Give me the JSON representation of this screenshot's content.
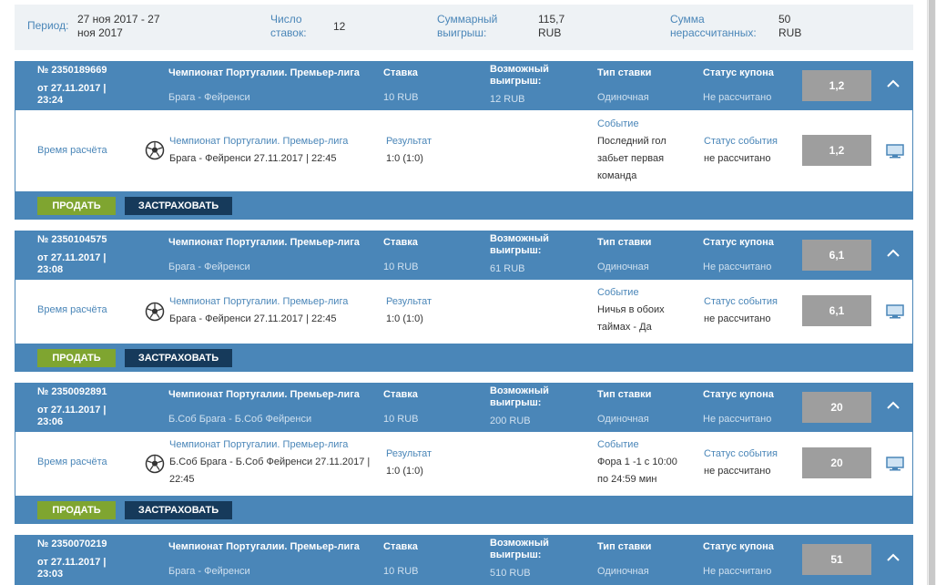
{
  "summary": {
    "period_label": "Период:",
    "period_value_1": "27 ноя 2017 - 27",
    "period_value_2": "ноя 2017",
    "count_label_1": "Число",
    "count_label_2": "ставок:",
    "count_value": "12",
    "win_label_1": "Суммарный",
    "win_label_2": "выигрыш:",
    "win_value_1": "115,7",
    "win_value_2": "RUB",
    "unsettled_label_1": "Сумма",
    "unsettled_label_2": "нерассчитанных:",
    "unsettled_value_1": "50",
    "unsettled_value_2": "RUB"
  },
  "labels": {
    "stake": "Ставка",
    "possible_win_1": "Возможный",
    "possible_win_2": "выигрыш:",
    "bet_type": "Тип ставки",
    "coupon_status": "Статус купона",
    "calc_time": "Время расчёта",
    "result": "Результат",
    "event": "Событие",
    "event_status": "Статус события",
    "sell": "ПРОДАТЬ",
    "insure": "ЗАСТРАХОВАТЬ"
  },
  "bets": [
    {
      "number": "№ 2350189669",
      "date_1": "от 27.11.2017 |",
      "date_2": "23:24",
      "league": "Чемпионат Португалии. Премьер-лига",
      "match": "Брага - Фейренси",
      "stake": "10 RUB",
      "possible_win": "12 RUB",
      "bet_type": "Одиночная",
      "coupon_status": "Не рассчитано",
      "coef": "1,2",
      "detail_league": "Чемпионат Португалии. Премьер-лига",
      "detail_match_1": "Брага - Фейренси 27.11.2017 | 22:45",
      "detail_match_2": "",
      "result": "1:0 (1:0)",
      "event_1": "Последний гол",
      "event_2": "забьет первая",
      "event_3": "команда",
      "event_status": "не рассчитано",
      "detail_coef": "1,2"
    },
    {
      "number": "№ 2350104575",
      "date_1": "от 27.11.2017 |",
      "date_2": "23:08",
      "league": "Чемпионат Португалии. Премьер-лига",
      "match": "Брага - Фейренси",
      "stake": "10 RUB",
      "possible_win": "61 RUB",
      "bet_type": "Одиночная",
      "coupon_status": "Не рассчитано",
      "coef": "6,1",
      "detail_league": "Чемпионат Португалии. Премьер-лига",
      "detail_match_1": "Брага - Фейренси 27.11.2017 | 22:45",
      "detail_match_2": "",
      "result": "1:0 (1:0)",
      "event_1": "Ничья в обоих",
      "event_2": "таймах - Да",
      "event_3": "",
      "event_status": "не рассчитано",
      "detail_coef": "6,1"
    },
    {
      "number": "№ 2350092891",
      "date_1": "от 27.11.2017 |",
      "date_2": "23:06",
      "league": "Чемпионат Португалии. Премьер-лига",
      "match": "Б.Соб Брага - Б.Соб Фейренси",
      "stake": "10 RUB",
      "possible_win": "200 RUB",
      "bet_type": "Одиночная",
      "coupon_status": "Не рассчитано",
      "coef": "20",
      "detail_league": "Чемпионат Португалии. Премьер-лига",
      "detail_match_1": "Б.Соб Брага - Б.Соб Фейренси 27.11.2017 |",
      "detail_match_2": "22:45",
      "result": "1:0 (1:0)",
      "event_1": "Фора 1 -1 с 10:00",
      "event_2": "по 24:59 мин",
      "event_3": "",
      "event_status": "не рассчитано",
      "detail_coef": "20"
    },
    {
      "number": "№ 2350070219",
      "date_1": "от 27.11.2017 |",
      "date_2": "23:03",
      "league": "Чемпионат Португалии. Премьер-лига",
      "match": "Брага - Фейренси",
      "stake": "10 RUB",
      "possible_win": "510 RUB",
      "bet_type": "Одиночная",
      "coupon_status": "Не рассчитано",
      "coef": "51"
    }
  ]
}
